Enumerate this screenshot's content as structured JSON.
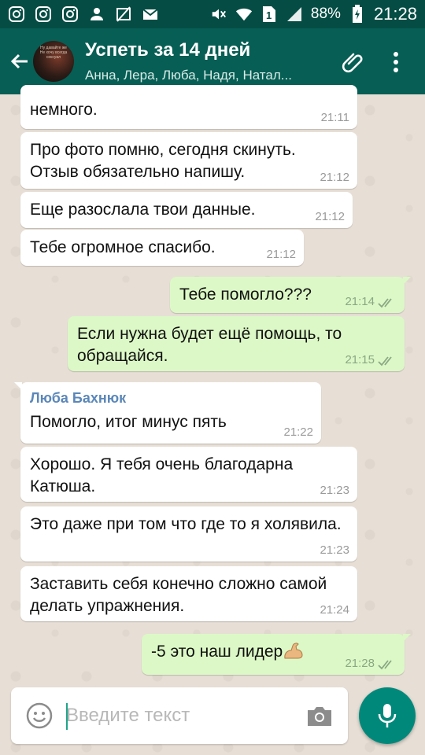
{
  "status_bar": {
    "battery": "88%",
    "time": "21:28",
    "icons": [
      "instagram-icon",
      "instagram-icon",
      "instagram-icon",
      "person-icon",
      "no-image-icon",
      "mail-icon",
      "mute-icon",
      "wifi-icon",
      "sim-icon",
      "signal-icon",
      "battery-icon"
    ]
  },
  "header": {
    "title": "Успеть за 14 дней",
    "subtitle": "Анна, Лера, Люба, Надя, Натал...",
    "avatar_text": "Ну давайте же Не хочу всегда сексуал",
    "icons": [
      "back-arrow-icon",
      "paperclip-icon",
      "more-vert-icon"
    ]
  },
  "messages": [
    {
      "dir": "in",
      "text": "немного.",
      "time": "21:11"
    },
    {
      "dir": "in",
      "text": "Про фото помню, сегодня скинуть. Отзыв обязательно напишу.",
      "time": "21:12"
    },
    {
      "dir": "in",
      "text": "Еще разослала  твои данные.",
      "time": "21:12"
    },
    {
      "dir": "in",
      "text": "Тебе огромное спасибо.",
      "time": "21:12"
    },
    {
      "dir": "out",
      "text": "Тебе помогло???",
      "time": "21:14"
    },
    {
      "dir": "out",
      "text": "Если нужна будет ещё помощь, то обращайся.",
      "time": "21:15"
    },
    {
      "dir": "in",
      "sender": "Люба Бахнюк",
      "text": "Помогло, итог минус пять",
      "time": "21:22"
    },
    {
      "dir": "in",
      "text": "Хорошо. Я тебя очень благодарна Катюша.",
      "time": "21:23"
    },
    {
      "dir": "in",
      "text": "Это даже при том что где то я холявила.",
      "time": "21:23"
    },
    {
      "dir": "in",
      "text": "Заставить себя конечно сложно самой делать упражнения.",
      "time": "21:24"
    },
    {
      "dir": "out",
      "text": "-5 это наш лидер",
      "time": "21:28",
      "emoji": "flexed-biceps"
    }
  ],
  "input": {
    "placeholder": "Введите текст"
  },
  "colors": {
    "status_bar": "#054d44",
    "app_bar": "#075e54",
    "outgoing_bubble": "#dcf8c6",
    "incoming_bubble": "#ffffff",
    "sender_name": "#5b87b9",
    "mic_button": "#00897b"
  }
}
